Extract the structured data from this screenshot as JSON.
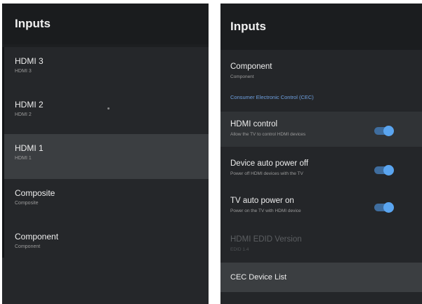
{
  "left_panel": {
    "title": "Inputs",
    "items": [
      {
        "label": "HDMI 3",
        "sub": "HDMI 3"
      },
      {
        "label": "HDMI 2",
        "sub": "HDMI 2"
      },
      {
        "label": "HDMI 1",
        "sub": "HDMI 1",
        "selected": true
      },
      {
        "label": "Composite",
        "sub": "Composite"
      },
      {
        "label": "Component",
        "sub": "Component"
      }
    ]
  },
  "right_panel": {
    "title": "Inputs",
    "component": {
      "label": "Component",
      "sub": "Component"
    },
    "section_label": "Consumer Electronic Control (CEC)",
    "toggles": [
      {
        "label": "HDMI control",
        "sub": "Allow the TV to control HDMI devices",
        "on": true
      },
      {
        "label": "Device auto power off",
        "sub": "Power off HDMI devices with the TV",
        "on": true
      },
      {
        "label": "TV auto power on",
        "sub": "Power on the TV with HDMI device",
        "on": true
      }
    ],
    "edid": {
      "label": "HDMI EDID Version",
      "sub": "EDID 1.4"
    },
    "cec_device_list": "CEC Device List"
  },
  "colors": {
    "background": "#1d1f21",
    "selected_row": "#3b3e41",
    "accent_blue": "#5aa5f0"
  }
}
